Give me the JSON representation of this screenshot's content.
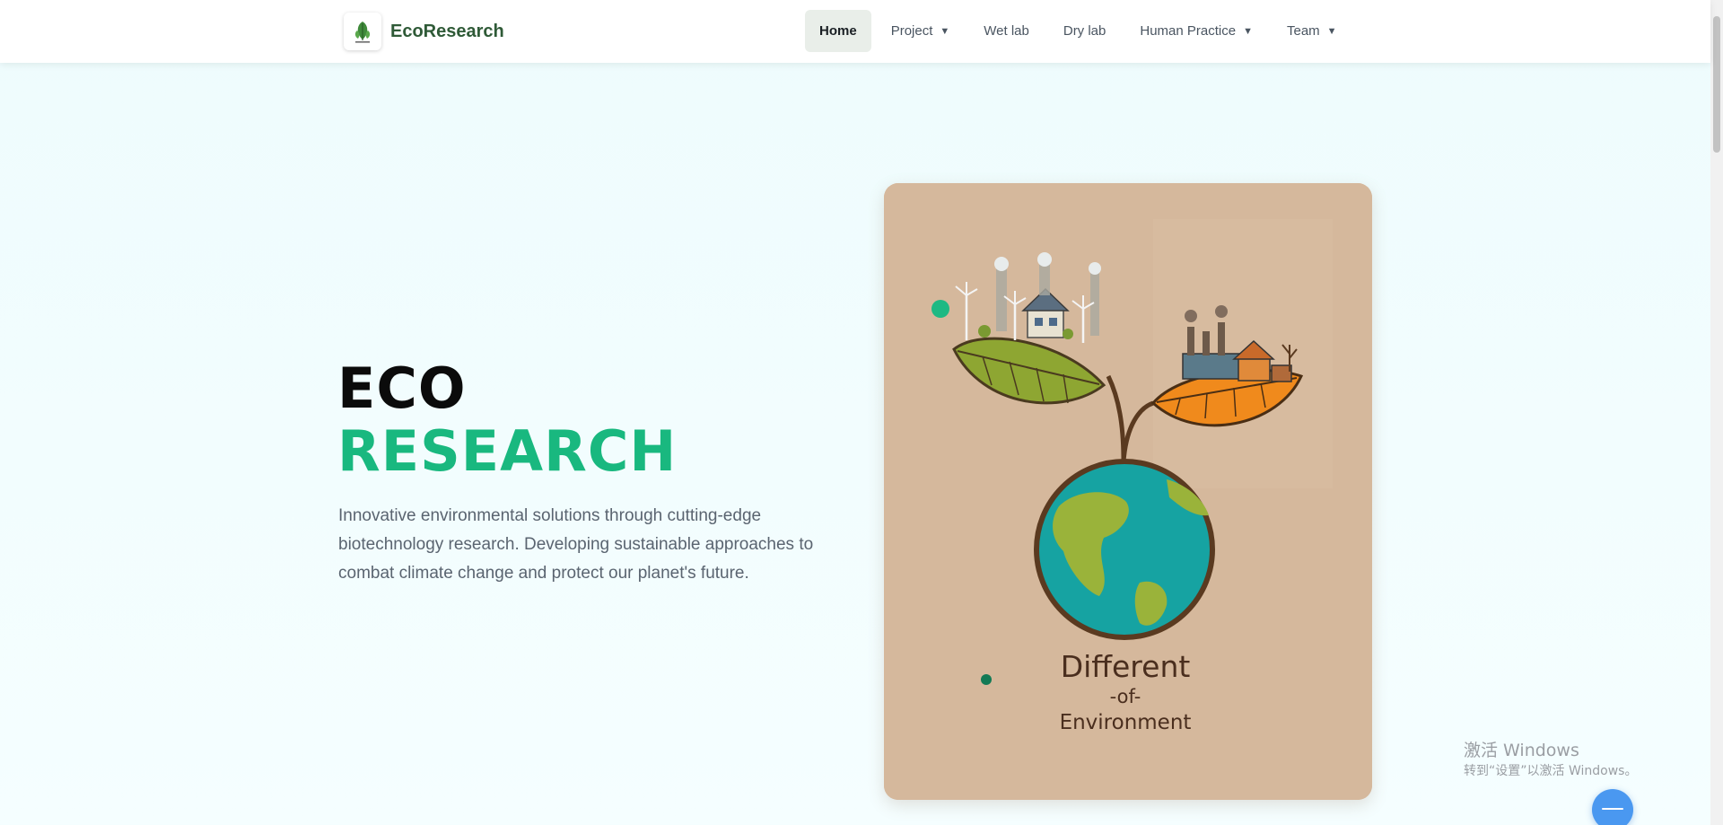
{
  "brand": {
    "name": "EcoResearch",
    "logo_icon": "leaf-logo-icon"
  },
  "nav": {
    "items": [
      {
        "label": "Home",
        "active": true,
        "dropdown": false
      },
      {
        "label": "Project",
        "active": false,
        "dropdown": true
      },
      {
        "label": "Wet lab",
        "active": false,
        "dropdown": false
      },
      {
        "label": "Dry lab",
        "active": false,
        "dropdown": false
      },
      {
        "label": "Human Practice",
        "active": false,
        "dropdown": true
      },
      {
        "label": "Team",
        "active": false,
        "dropdown": true
      }
    ],
    "caret": "▼"
  },
  "hero": {
    "title_line1": "ECO",
    "title_line2": "RESEARCH",
    "description": "Innovative environmental solutions through cutting-edge biotechnology research. Developing sustainable approaches to combat climate change and protect our planet's future."
  },
  "poster": {
    "text_line1": "Different",
    "text_line2": "-of-",
    "text_line3": "Environment"
  },
  "watermark": {
    "line1": "激活 Windows",
    "line2": "转到“设置”以激活 Windows。"
  },
  "colors": {
    "accent": "#19b87f",
    "brand_text": "#2f5a37",
    "poster_bg": "#d5b89c",
    "nav_active_bg": "#e9eee9"
  }
}
